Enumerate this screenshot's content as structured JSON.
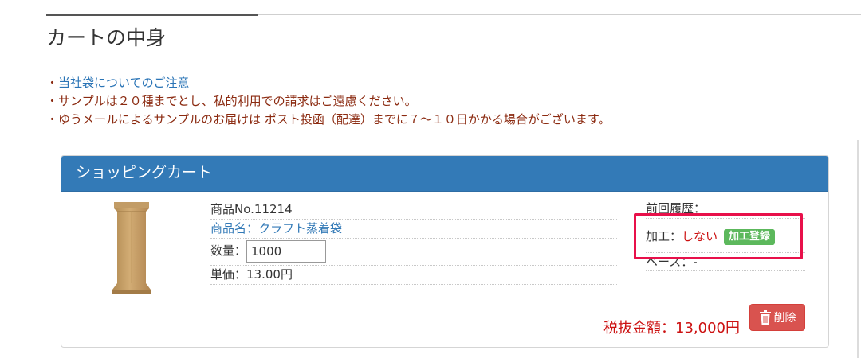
{
  "page": {
    "title": "カートの中身"
  },
  "notes": {
    "bullet": "・",
    "link_label": "当社袋についてのご注意",
    "line2": "サンプルは２０種までとし、私的利用での請求はご遠慮ください。",
    "line3": "ゆうメールによるサンプルのお届けは ポスト投函（配達）までに７～１０日かかる場合がございます。"
  },
  "cart": {
    "header": "ショッピングカート",
    "item": {
      "product_no": "商品No.11214",
      "name": "商品名：クラフト蒸着袋",
      "quantity_label": "数量：",
      "quantity_value": "1000",
      "unit_price": "単価：13.00円",
      "history_label": "前回履歴：",
      "processing_label": "加工：",
      "processing_value": "しない",
      "processing_button": "加工登録",
      "base_label": "ベース：-"
    },
    "total": "税抜金額：13,000円",
    "delete_button": "削除"
  },
  "colors": {
    "header_blue": "#337ab7",
    "note_text": "#8b2a10",
    "link": "#2a74b6",
    "price_red": "#cc1111",
    "button_green": "#5cb85c",
    "button_red": "#d9534f",
    "highlight": "#e8104a"
  },
  "icons": {
    "product": "kraft-bag-image",
    "delete": "trash-icon"
  }
}
